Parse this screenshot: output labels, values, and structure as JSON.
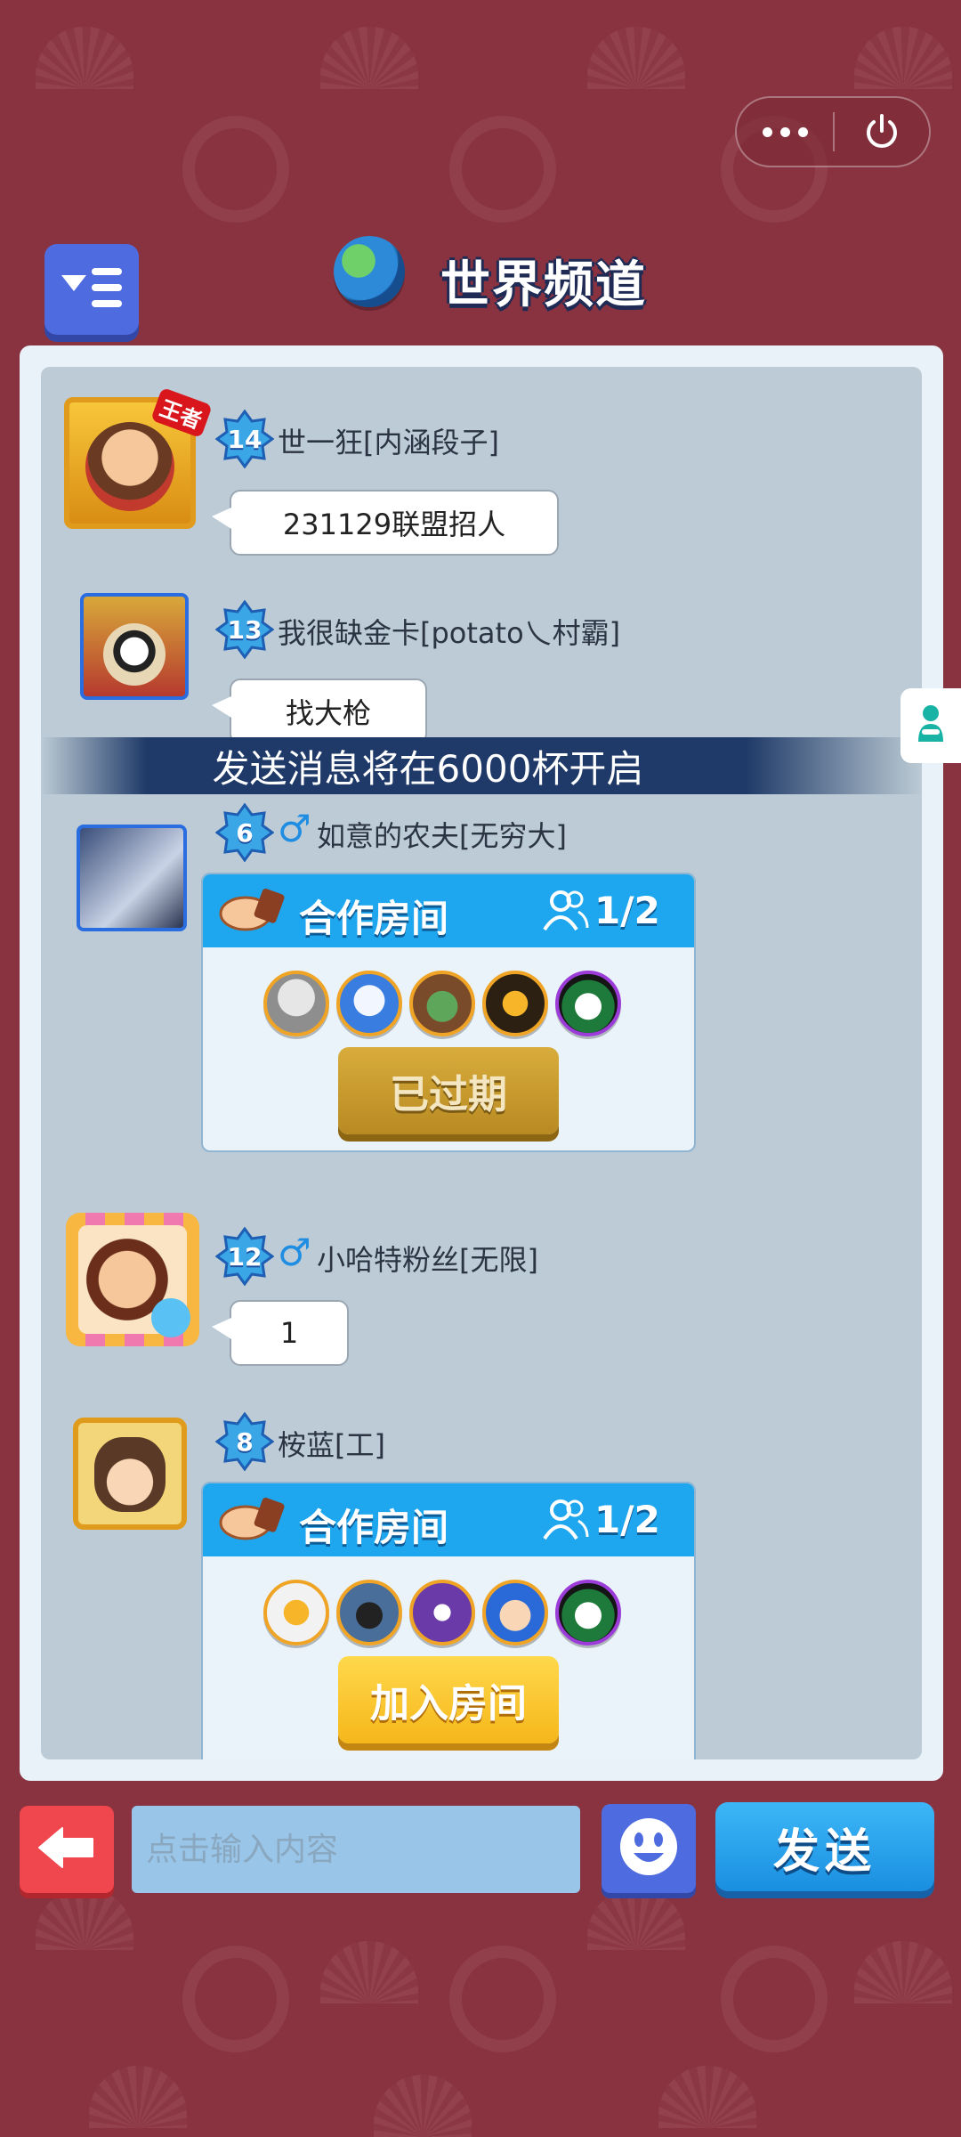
{
  "header": {
    "title": "世界频道"
  },
  "notice": "发送消息将在6000杯开启",
  "messages": [
    {
      "level": "14",
      "name": "世一狂[内涵段子]",
      "frame_text": "王者",
      "text": "231129联盟招人"
    },
    {
      "level": "13",
      "name": "我很缺金卡[potato乀村霸]",
      "text": "找大枪"
    },
    {
      "level": "6",
      "gender": "♂",
      "name": "如意的农夫[无穷大]",
      "room": {
        "title": "合作房间",
        "count": "1/2",
        "button": "已过期",
        "status": "expired"
      }
    },
    {
      "level": "12",
      "gender": "♂",
      "name": "小哈特粉丝[无限]",
      "text": "1"
    },
    {
      "level": "8",
      "name": "桉蓝[工]",
      "room": {
        "title": "合作房间",
        "count": "1/2",
        "button": "加入房间",
        "status": "open"
      }
    }
  ],
  "input": {
    "placeholder": "点击输入内容",
    "value": ""
  },
  "send_label": "发送",
  "icons": {
    "capsule_more": "more-dots-icon",
    "capsule_close": "power-icon",
    "menu": "menu-list-icon",
    "globe": "globe-icon",
    "back": "arrow-left-icon",
    "emoji": "smiley-icon",
    "side": "character-icon"
  },
  "colors": {
    "background": "#8a3340",
    "chat_panel": "#bccbd5",
    "room_header": "#1ea7ee",
    "send_button": "#1a8fe0"
  }
}
